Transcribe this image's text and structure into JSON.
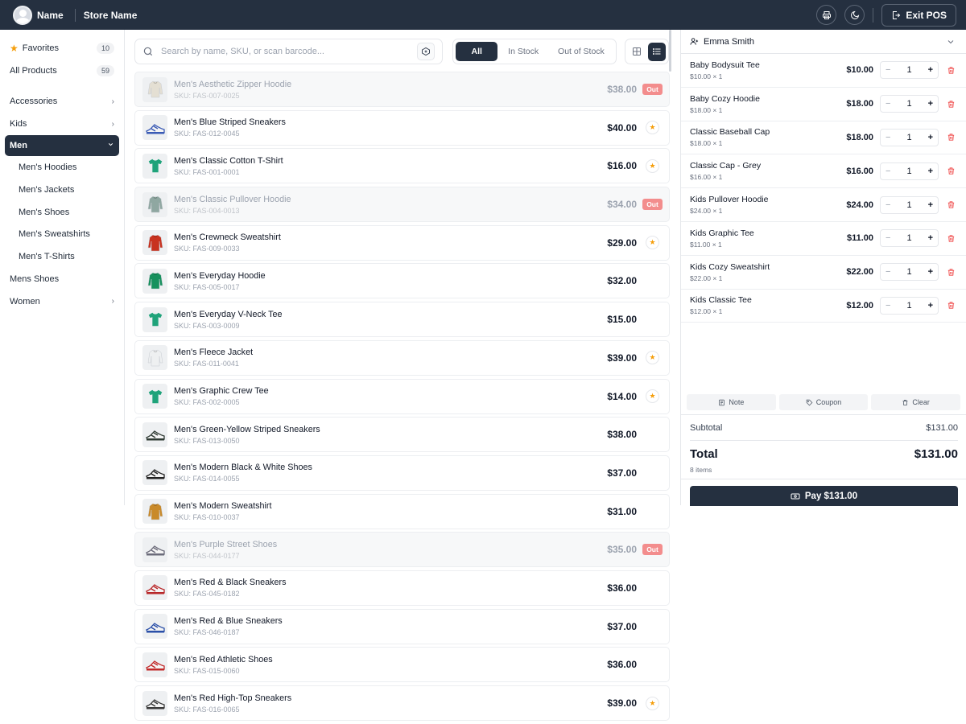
{
  "topbar": {
    "user_name": "Name",
    "store_name": "Store Name",
    "exit_label": "Exit POS",
    "icons": [
      "user-avatar",
      "printer-icon",
      "moon-icon",
      "exit-icon"
    ]
  },
  "sidebar": {
    "favorites": {
      "label": "Favorites",
      "count": "10"
    },
    "all_products": {
      "label": "All Products",
      "count": "59"
    },
    "categories": [
      {
        "label": "Accessories",
        "expandable": true
      },
      {
        "label": "Kids",
        "expandable": true
      },
      {
        "label": "Men",
        "expandable": true,
        "active": true
      }
    ],
    "men_sub": [
      "Men's Hoodies",
      "Men's Jackets",
      "Men's Shoes",
      "Men's Sweatshirts",
      "Men's T-Shirts"
    ],
    "others": [
      {
        "label": "Mens Shoes",
        "expandable": false
      },
      {
        "label": "Women",
        "expandable": true
      }
    ]
  },
  "search": {
    "placeholder": "Search by name, SKU, or scan barcode..."
  },
  "filters": [
    "All",
    "In Stock",
    "Out of Stock"
  ],
  "active_filter": "All",
  "products": [
    {
      "name": "Men's Aesthetic Zipper Hoodie",
      "sku": "SKU: FAS-007-0025",
      "price": "$38.00",
      "status": "Out",
      "type": "hoodie",
      "color": "#e4dfd3"
    },
    {
      "name": "Men's Blue Striped Sneakers",
      "sku": "SKU: FAS-012-0045",
      "price": "$40.00",
      "status": "fav",
      "type": "shoe",
      "color": "#3b5bb5"
    },
    {
      "name": "Men's Classic Cotton T-Shirt",
      "sku": "SKU: FAS-001-0001",
      "price": "$16.00",
      "status": "fav",
      "type": "tee",
      "color": "#1fa37a"
    },
    {
      "name": "Men's Classic Pullover Hoodie",
      "sku": "SKU: FAS-004-0013",
      "price": "$34.00",
      "status": "Out",
      "type": "hoodie",
      "color": "#8fa7a1"
    },
    {
      "name": "Men's Crewneck Sweatshirt",
      "sku": "SKU: FAS-009-0033",
      "price": "$29.00",
      "status": "fav",
      "type": "hoodie",
      "color": "#c8321f"
    },
    {
      "name": "Men's Everyday Hoodie",
      "sku": "SKU: FAS-005-0017",
      "price": "$32.00",
      "status": "",
      "type": "hoodie",
      "color": "#17915e"
    },
    {
      "name": "Men's Everyday V-Neck Tee",
      "sku": "SKU: FAS-003-0009",
      "price": "$15.00",
      "status": "",
      "type": "tee",
      "color": "#1fa37a"
    },
    {
      "name": "Men's Fleece Jacket",
      "sku": "SKU: FAS-011-0041",
      "price": "$39.00",
      "status": "fav",
      "type": "hoodie",
      "color": "#eef0f1"
    },
    {
      "name": "Men's Graphic Crew Tee",
      "sku": "SKU: FAS-002-0005",
      "price": "$14.00",
      "status": "fav",
      "type": "tee",
      "color": "#1fa37a"
    },
    {
      "name": "Men's Green-Yellow Striped Sneakers",
      "sku": "SKU: FAS-013-0050",
      "price": "$38.00",
      "status": "",
      "type": "shoe",
      "color": "#2f3a33"
    },
    {
      "name": "Men's Modern Black & White Shoes",
      "sku": "SKU: FAS-014-0055",
      "price": "$37.00",
      "status": "",
      "type": "shoe",
      "color": "#222222"
    },
    {
      "name": "Men's Modern Sweatshirt",
      "sku": "SKU: FAS-010-0037",
      "price": "$31.00",
      "status": "",
      "type": "hoodie",
      "color": "#c98a2a"
    },
    {
      "name": "Men's Purple Street Shoes",
      "sku": "SKU: FAS-044-0177",
      "price": "$35.00",
      "status": "Out",
      "type": "shoe",
      "color": "#6b6b7a"
    },
    {
      "name": "Men's Red & Black Sneakers",
      "sku": "SKU: FAS-045-0182",
      "price": "$36.00",
      "status": "",
      "type": "shoe",
      "color": "#b8282a"
    },
    {
      "name": "Men's Red & Blue Sneakers",
      "sku": "SKU: FAS-046-0187",
      "price": "$37.00",
      "status": "",
      "type": "shoe",
      "color": "#2a4fa8"
    },
    {
      "name": "Men's Red Athletic Shoes",
      "sku": "SKU: FAS-015-0060",
      "price": "$36.00",
      "status": "",
      "type": "shoe",
      "color": "#c12a2a"
    },
    {
      "name": "Men's Red High-Top Sneakers",
      "sku": "SKU: FAS-016-0065",
      "price": "$39.00",
      "status": "fav",
      "type": "shoe",
      "color": "#3a3a3a"
    }
  ],
  "cart": {
    "customer": "Emma Smith",
    "items": [
      {
        "name": "Baby Bodysuit Tee",
        "unit": "$10.00 × 1",
        "price": "$10.00",
        "qty": "1"
      },
      {
        "name": "Baby Cozy Hoodie",
        "unit": "$18.00 × 1",
        "price": "$18.00",
        "qty": "1"
      },
      {
        "name": "Classic Baseball Cap",
        "unit": "$18.00 × 1",
        "price": "$18.00",
        "qty": "1"
      },
      {
        "name": "Classic Cap - Grey",
        "unit": "$16.00 × 1",
        "price": "$16.00",
        "qty": "1"
      },
      {
        "name": "Kids Pullover Hoodie",
        "unit": "$24.00 × 1",
        "price": "$24.00",
        "qty": "1"
      },
      {
        "name": "Kids Graphic Tee",
        "unit": "$11.00 × 1",
        "price": "$11.00",
        "qty": "1"
      },
      {
        "name": "Kids Cozy Sweatshirt",
        "unit": "$22.00 × 1",
        "price": "$22.00",
        "qty": "1"
      },
      {
        "name": "Kids Classic Tee",
        "unit": "$12.00 × 1",
        "price": "$12.00",
        "qty": "1"
      }
    ],
    "actions": [
      "Note",
      "Coupon",
      "Clear"
    ],
    "subtotal_label": "Subtotal",
    "subtotal": "$131.00",
    "total_label": "Total",
    "total": "$131.00",
    "items_count": "8 items",
    "pay_label": "Pay $131.00"
  },
  "colors": {
    "navy": "#253040",
    "out_badge": "#f38d8d",
    "star": "#f59e0b",
    "trash": "#ef4444"
  }
}
